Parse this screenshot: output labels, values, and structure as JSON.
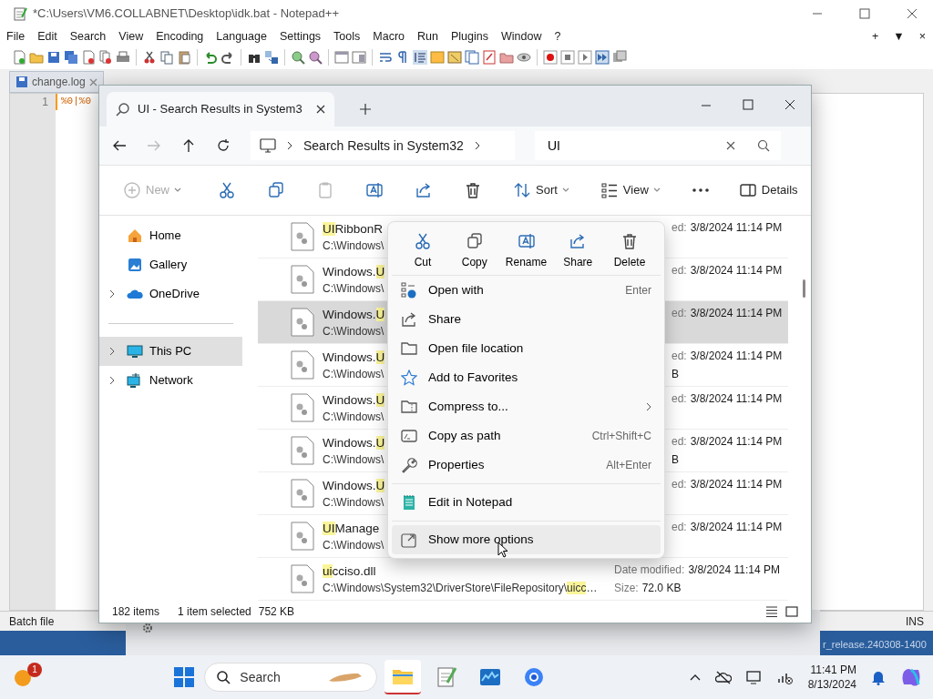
{
  "notepad": {
    "title": "*C:\\Users\\VM6.COLLABNET\\Desktop\\idk.bat - Notepad++",
    "menu": [
      "File",
      "Edit",
      "Search",
      "View",
      "Encoding",
      "Language",
      "Settings",
      "Tools",
      "Macro",
      "Run",
      "Plugins",
      "Window",
      "?"
    ],
    "menu_right": [
      "+",
      "▼",
      "×"
    ],
    "tabs": [
      {
        "label": "change.log",
        "selected": false
      }
    ],
    "line_number": "1",
    "code": "%0|%0",
    "status_left": "Batch file",
    "status_right": "INS"
  },
  "desktop_text": "r_release.240308-1400",
  "explorer": {
    "tab_title": "UI - Search Results in System3",
    "address": "Search Results in System32",
    "search_value": "UI",
    "toolbar": [
      {
        "kind": "new",
        "label": "New",
        "disabled": true
      },
      {
        "kind": "cut",
        "disabled": false
      },
      {
        "kind": "copy",
        "disabled": false
      },
      {
        "kind": "paste",
        "disabled": true
      },
      {
        "kind": "rename",
        "disabled": false
      },
      {
        "kind": "share",
        "disabled": false
      },
      {
        "kind": "delete",
        "disabled": false
      },
      {
        "kind": "sort",
        "label": "Sort",
        "disabled": false
      },
      {
        "kind": "view",
        "label": "View",
        "disabled": false
      },
      {
        "kind": "more",
        "disabled": false
      },
      {
        "kind": "details",
        "label": "Details",
        "disabled": false
      }
    ],
    "nav": [
      {
        "kind": "home",
        "label": "Home",
        "expandable": false,
        "selected": false
      },
      {
        "kind": "gallery",
        "label": "Gallery",
        "expandable": false,
        "selected": false
      },
      {
        "kind": "cloud",
        "label": "OneDrive",
        "expandable": true,
        "selected": false
      },
      {
        "kind": "separator"
      },
      {
        "kind": "pc",
        "label": "This PC",
        "expandable": true,
        "selected": true
      },
      {
        "kind": "network",
        "label": "Network",
        "expandable": true,
        "selected": false
      }
    ],
    "rows": [
      {
        "kind": "covered",
        "selected": false,
        "name": [
          {
            "text": "UI",
            "match": true
          },
          {
            "text": "RibbonR",
            "match": false
          }
        ],
        "path": [
          {
            "text": "C:\\Windows\\",
            "match": false
          }
        ],
        "meta_fragment": "ed:",
        "date": "3/8/2024 11:14 PM"
      },
      {
        "kind": "covered",
        "selected": false,
        "name": [
          {
            "text": "Windows.",
            "match": false
          },
          {
            "text": "U",
            "match": true
          }
        ],
        "path": [
          {
            "text": "C:\\Windows\\",
            "match": false
          }
        ],
        "meta_fragment": "ed:",
        "date": "3/8/2024 11:14 PM"
      },
      {
        "kind": "covered",
        "selected": true,
        "name": [
          {
            "text": "Windows.",
            "match": false
          },
          {
            "text": "U",
            "match": true
          }
        ],
        "path": [
          {
            "text": "C:\\Windows\\",
            "match": false
          }
        ],
        "meta_fragment": "ed:",
        "date": "3/8/2024 11:14 PM"
      },
      {
        "kind": "covered",
        "selected": false,
        "name": [
          {
            "text": "Windows.",
            "match": false
          },
          {
            "text": "U",
            "match": true
          }
        ],
        "path": [
          {
            "text": "C:\\Windows\\",
            "match": false
          }
        ],
        "meta_fragment": "ed:",
        "date": "3/8/2024 11:14 PM",
        "size_fragment": "B"
      },
      {
        "kind": "covered",
        "selected": false,
        "name": [
          {
            "text": "Windows.",
            "match": false
          },
          {
            "text": "U",
            "match": true
          }
        ],
        "path": [
          {
            "text": "C:\\Windows\\",
            "match": false
          }
        ],
        "meta_fragment": "ed:",
        "date": "3/8/2024 11:14 PM"
      },
      {
        "kind": "covered",
        "selected": false,
        "name": [
          {
            "text": "Windows.",
            "match": false
          },
          {
            "text": "U",
            "match": true
          }
        ],
        "path": [
          {
            "text": "C:\\Windows\\",
            "match": false
          }
        ],
        "meta_fragment": "ed:",
        "date": "3/8/2024 11:14 PM",
        "size_fragment": "B"
      },
      {
        "kind": "covered",
        "selected": false,
        "name": [
          {
            "text": "Windows.",
            "match": false
          },
          {
            "text": "U",
            "match": true
          }
        ],
        "path": [
          {
            "text": "C:\\Windows\\",
            "match": false
          }
        ],
        "meta_fragment": "ed:",
        "date": "3/8/2024 11:14 PM"
      },
      {
        "kind": "covered",
        "selected": false,
        "name": [
          {
            "text": "UI",
            "match": true
          },
          {
            "text": "Manage",
            "match": false
          }
        ],
        "path": [
          {
            "text": "C:\\Windows\\",
            "match": false
          }
        ],
        "meta_fragment": "ed:",
        "date": "3/8/2024 11:14 PM"
      },
      {
        "kind": "full",
        "selected": false,
        "name": [
          {
            "text": "ui",
            "match": true
          },
          {
            "text": "cciso.dll",
            "match": false
          }
        ],
        "path": [
          {
            "text": "C:\\Windows\\System32\\DriverStore\\FileRepository\\",
            "match": false
          },
          {
            "text": "uicc",
            "match": true
          },
          {
            "text": "…",
            "match": false
          }
        ],
        "date_label": "Date modified:",
        "date": "3/8/2024 11:14 PM",
        "size_label": "Size:",
        "size": "72.0 KB"
      }
    ],
    "status": {
      "count": "182 items",
      "selection": "1 item selected",
      "size": "752 KB"
    }
  },
  "context_menu": {
    "actions": [
      {
        "kind": "cut",
        "label": "Cut"
      },
      {
        "kind": "copy",
        "label": "Copy"
      },
      {
        "kind": "rename",
        "label": "Rename"
      },
      {
        "kind": "share",
        "label": "Share"
      },
      {
        "kind": "delete",
        "label": "Delete"
      }
    ],
    "items": [
      {
        "kind": "open-with",
        "label": "Open with",
        "shortcut": "Enter",
        "submenu": false,
        "hovered": false
      },
      {
        "kind": "share",
        "label": "Share",
        "submenu": false,
        "hovered": false
      },
      {
        "kind": "folder",
        "label": "Open file location",
        "submenu": false,
        "hovered": false
      },
      {
        "kind": "star",
        "label": "Add to Favorites",
        "submenu": false,
        "hovered": false
      },
      {
        "kind": "zip",
        "label": "Compress to...",
        "submenu": true,
        "hovered": false
      },
      {
        "kind": "path",
        "label": "Copy as path",
        "shortcut": "Ctrl+Shift+C",
        "submenu": false,
        "hovered": false
      },
      {
        "kind": "wrench",
        "label": "Properties",
        "shortcut": "Alt+Enter",
        "submenu": false,
        "hovered": false
      },
      {
        "kind": "separator"
      },
      {
        "kind": "notepad",
        "label": "Edit in Notepad",
        "submenu": false,
        "hovered": false
      },
      {
        "kind": "separator"
      },
      {
        "kind": "more",
        "label": "Show more options",
        "submenu": false,
        "hovered": true
      }
    ]
  },
  "taskbar": {
    "badge": "1",
    "search_placeholder": "Search",
    "apps": [
      {
        "kind": "explorer",
        "selected": true
      },
      {
        "kind": "notepadpp",
        "selected": false
      },
      {
        "kind": "monitor",
        "selected": false
      },
      {
        "kind": "browser",
        "selected": false
      }
    ],
    "time": "11:41 PM",
    "date": "8/13/2024"
  }
}
